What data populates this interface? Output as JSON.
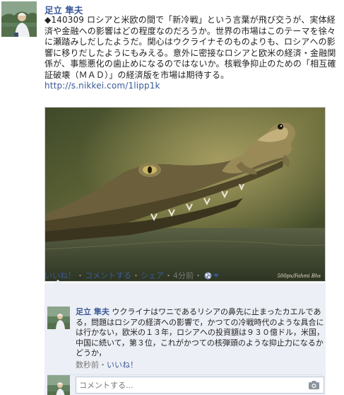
{
  "post": {
    "author": "足立 隼夫",
    "text": "◆140309 ロシアと米欧の間で「新冷戦」という言葉が飛び交うが、実体経済や金融への影響はどの程度なのだろうか。世界の市場はこのテーマを徐々に瀬踏みしだしたようだ。関心はウクライナそのものよりも、ロシアへの影響に移りだしたようにもみえる。意外に密接なロシアと欧米の経済・金融関係が、事態悪化の歯止めになるのではないか。核戦争抑止のための「相互確証破壊（ＭＡＤ）」の経済版を市場は期待する。",
    "link": "http://s.nikkei.com/1lipp1k",
    "photo_credit": "500px/Fahmi Bhs"
  },
  "actions": {
    "like": "いいね！",
    "comment": "コメントする",
    "share": "シェア",
    "time": "4分前",
    "separator": "・",
    "audience_icon": "globe-icon"
  },
  "comment": {
    "author": "足立 隼夫",
    "text": "ウクライナはワニであるリシアの鼻先に止まったカエルである，問題はロシアの経済への影響で，かつての冷戦時代のような具合には行かない，欧米の１３年，ロシアへの投資額は９３０億ドル，米国，中国に続いて，第３位，これがかつての核弾頭のような抑止力になるかどうか，",
    "time": "数秒前",
    "separator": "・",
    "like": "いいね！"
  },
  "reply": {
    "placeholder": "コメントする...",
    "camera_icon": "camera-icon"
  },
  "colors": {
    "link": "#3b5998",
    "ufi_background": "#eceff5"
  }
}
